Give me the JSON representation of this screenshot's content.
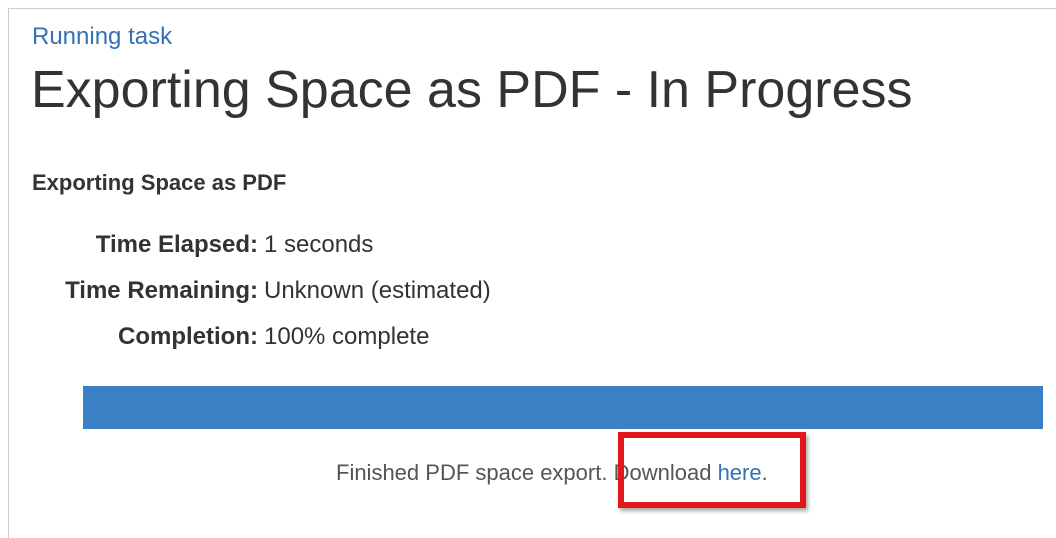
{
  "breadcrumb": {
    "label": "Running task"
  },
  "page": {
    "title": "Exporting Space as PDF - In Progress"
  },
  "task": {
    "heading": "Exporting Space as PDF",
    "stats": [
      {
        "label": "Time Elapsed:",
        "value": "1 seconds"
      },
      {
        "label": "Time Remaining:",
        "value": "Unknown (estimated)"
      },
      {
        "label": "Completion:",
        "value": "100% complete"
      }
    ],
    "progress_percent": 100
  },
  "result": {
    "message": "Finished PDF space export.",
    "download_prefix": "Download",
    "download_link": "here",
    "download_suffix": "."
  },
  "colors": {
    "link": "#3572b0",
    "progress_fill": "#3b7fc4",
    "highlight": "#e3161b"
  }
}
